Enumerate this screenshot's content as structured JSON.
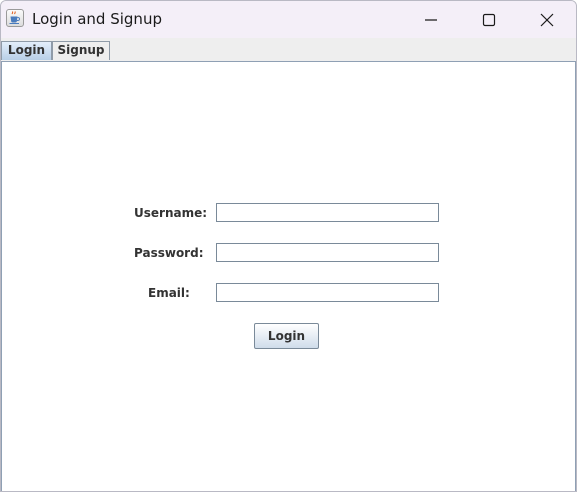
{
  "window": {
    "title": "Login and Signup",
    "icon": "java-cup-icon",
    "controls": [
      "minimize-icon",
      "maximize-icon",
      "close-icon"
    ]
  },
  "tabs": [
    {
      "label": "Login",
      "selected": true
    },
    {
      "label": "Signup",
      "selected": false
    }
  ],
  "form": {
    "username_label": "Username:",
    "username_value": "",
    "password_label": "Password:",
    "password_value": "",
    "email_label": "Email:",
    "email_value": "",
    "submit_label": "Login"
  },
  "colors": {
    "selected_tab": "#b8cfe7",
    "button_gradient_end": "#cfdcea",
    "field_border": "#7a8a99"
  }
}
